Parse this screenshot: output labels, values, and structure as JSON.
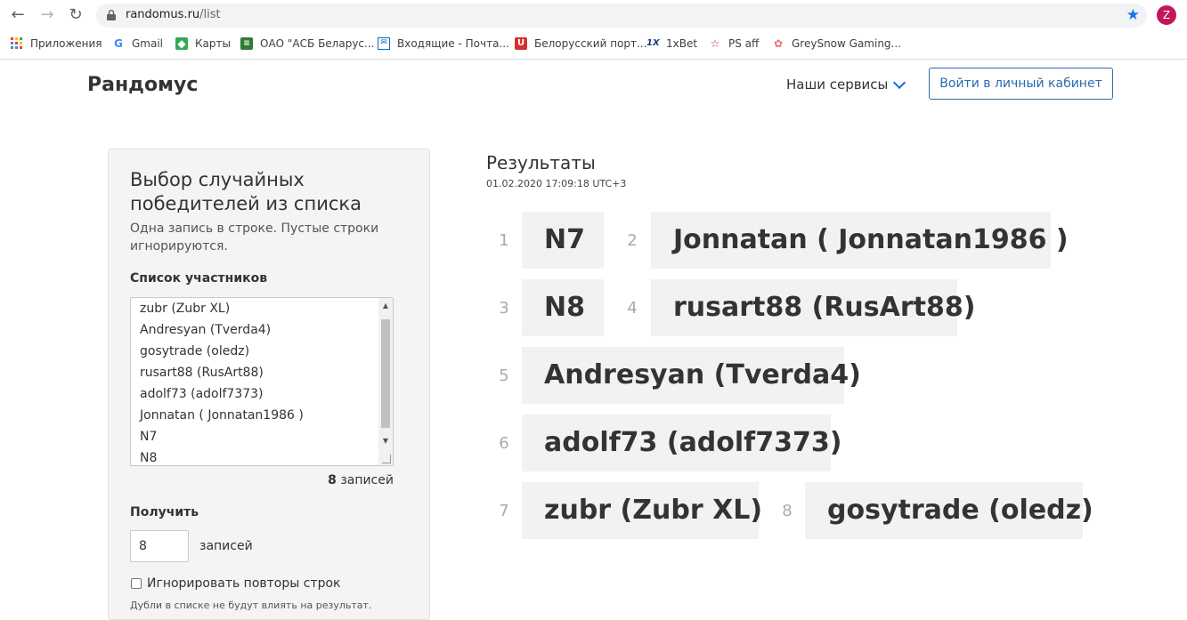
{
  "browser": {
    "url_host": "randomus.ru",
    "url_path": "/list",
    "profile_initial": "Z",
    "bookmarks": [
      {
        "label": "Приложения",
        "icon": "apps-grid-icon"
      },
      {
        "label": "Gmail",
        "icon": "google-icon"
      },
      {
        "label": "Карты",
        "icon": "maps-icon"
      },
      {
        "label": "ОАО \"АСБ Беларус...",
        "icon": "rss-icon"
      },
      {
        "label": "Входящие - Почта...",
        "icon": "mail-icon"
      },
      {
        "label": "Белорусский порт...",
        "icon": "tutby-icon"
      },
      {
        "label": "1xBet",
        "icon": "1xbet-icon"
      },
      {
        "label": "PS aff",
        "icon": "star-outline-icon"
      },
      {
        "label": "GreySnow Gaming...",
        "icon": "greysnow-icon"
      }
    ]
  },
  "header": {
    "brand": "Рандомус",
    "services_label": "Наши сервисы",
    "login_label": "Войти в личный кабинет"
  },
  "form": {
    "title": "Выбор случайных победителей из списка",
    "description": "Одна запись в строке. Пустые строки игнорируются.",
    "list_label": "Список участников",
    "list_lines": [
      "zubr (Zubr XL)",
      "Andresyan (Tverda4)",
      "gosytrade (oledz)",
      "rusart88 (RusArt88)",
      "adolf73 (adolf7373)",
      "Jonnatan ( Jonnatan1986 )",
      "N7",
      "N8"
    ],
    "count_value": "8",
    "count_unit": "записей",
    "get_label": "Получить",
    "get_value": "8",
    "get_unit": "записей",
    "ignore_label": "Игнорировать повторы строк",
    "ignore_checked": false,
    "hint": "Дубли в списке не будут влиять на результат."
  },
  "results": {
    "title": "Результаты",
    "timestamp": "01.02.2020 17:09:18 UTC+3",
    "items": [
      {
        "n": "1",
        "name": "N7"
      },
      {
        "n": "2",
        "name": "Jonnatan ( Jonnatan1986 )"
      },
      {
        "n": "3",
        "name": "N8"
      },
      {
        "n": "4",
        "name": "rusart88 (RusArt88)"
      },
      {
        "n": "5",
        "name": "Andresyan (Tverda4)"
      },
      {
        "n": "6",
        "name": "adolf73 (adolf7373)"
      },
      {
        "n": "7",
        "name": "zubr (Zubr XL)"
      },
      {
        "n": "8",
        "name": "gosytrade (oledz)"
      }
    ]
  }
}
